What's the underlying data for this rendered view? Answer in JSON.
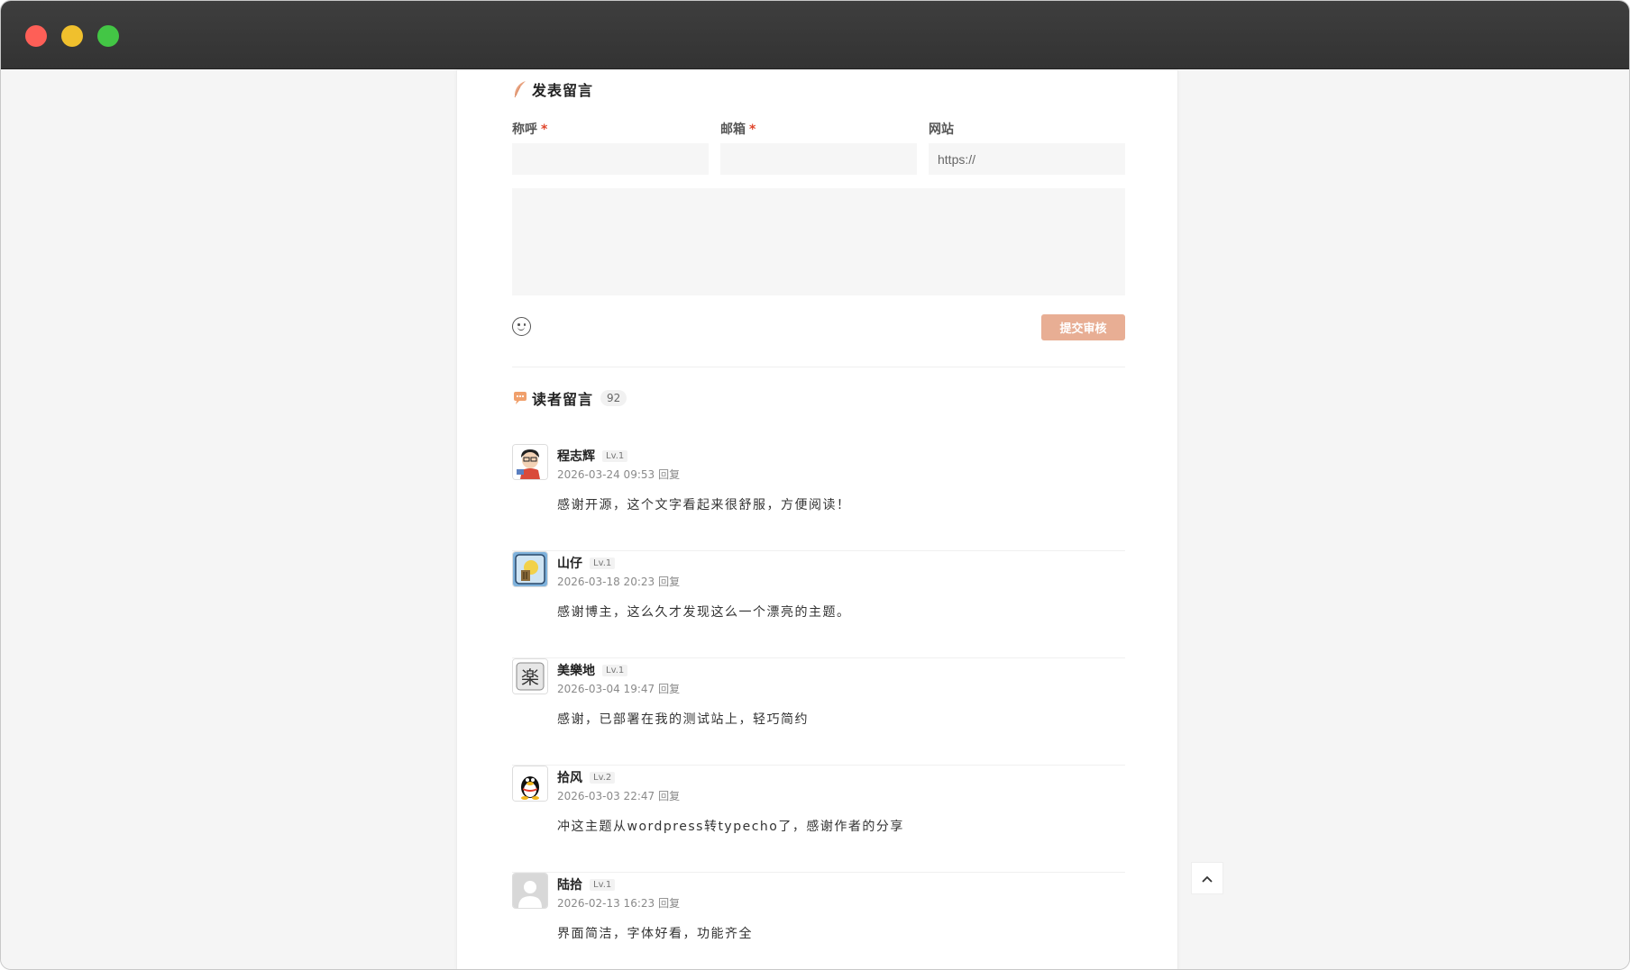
{
  "form": {
    "title": "发表留言",
    "name_label": "称呼",
    "email_label": "邮箱",
    "site_label": "网站",
    "required_mark": "*",
    "site_placeholder": "https://",
    "submit_label": "提交审核"
  },
  "comments_section": {
    "title": "读者留言",
    "count": "92"
  },
  "comments": [
    {
      "author": "程志辉",
      "level": "Lv.1",
      "date": "2026-03-24 09:53",
      "reply": "回复",
      "content": "感谢开源，这个文字看起来很舒服，方便阅读！"
    },
    {
      "author": "山仔",
      "level": "Lv.1",
      "date": "2026-03-18 20:23",
      "reply": "回复",
      "content": "感谢博主，这么久才发现这么一个漂亮的主题。"
    },
    {
      "author": "美樂地",
      "level": "Lv.1",
      "date": "2026-03-04 19:47",
      "reply": "回复",
      "content": "感谢，已部署在我的测试站上，轻巧简约"
    },
    {
      "author": "拾风",
      "level": "Lv.2",
      "date": "2026-03-03 22:47",
      "reply": "回复",
      "content": "冲这主题从wordpress转typecho了，感谢作者的分享"
    },
    {
      "author": "陆拾",
      "level": "Lv.1",
      "date": "2026-02-13 16:23",
      "reply": "回复",
      "content": "界面简洁，字体好看，功能齐全"
    }
  ],
  "avatar_glyphs": {
    "melody": "楽"
  },
  "colors": {
    "accent": "#e8ae94",
    "required": "#e0452b",
    "titlebar": "#3a3a3a"
  },
  "icons": [
    "feather-icon",
    "chat-bubble-icon",
    "emoji-icon",
    "chevron-up-icon"
  ]
}
